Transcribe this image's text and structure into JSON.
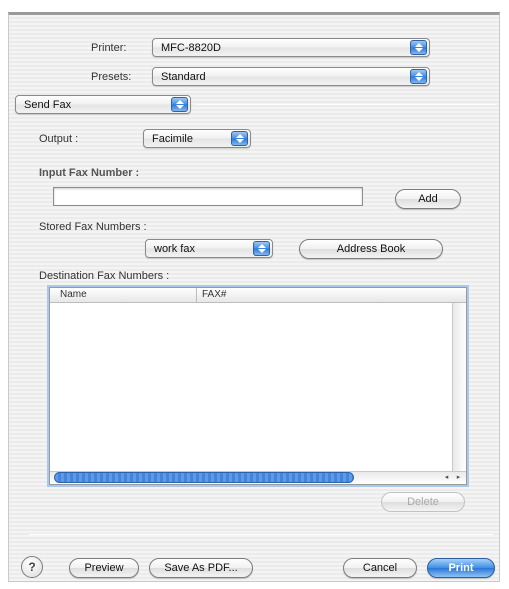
{
  "printer": {
    "label": "Printer:",
    "value": "MFC-8820D"
  },
  "presets": {
    "label": "Presets:",
    "value": "Standard"
  },
  "panel": {
    "value": "Send Fax"
  },
  "output": {
    "label": "Output :",
    "value": "Facimile"
  },
  "input_fax": {
    "label": "Input Fax Number :",
    "value": "",
    "add_label": "Add"
  },
  "stored_fax": {
    "label": "Stored Fax Numbers :",
    "value": "work fax",
    "address_book_label": "Address Book"
  },
  "destination": {
    "label": "Destination Fax Numbers :",
    "columns": [
      "Name",
      "FAX#"
    ],
    "rows": [],
    "delete_label": "Delete"
  },
  "footer": {
    "help_icon": "?",
    "preview_label": "Preview",
    "save_pdf_label": "Save As PDF...",
    "cancel_label": "Cancel",
    "print_label": "Print"
  },
  "scroll": {
    "left_arrow": "◂",
    "right_arrow": "▸"
  },
  "colors": {
    "accent": "#3f8ee3",
    "sheet_bg": "#f0f0f0"
  }
}
